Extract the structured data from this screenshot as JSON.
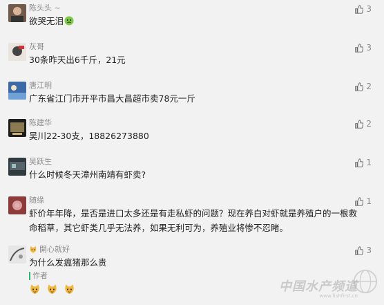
{
  "comments": [
    {
      "name": "陈头头 ~",
      "text": "欲哭无泪",
      "emoji": "sick-face",
      "likes": "3"
    },
    {
      "name": "灰哥",
      "text": "30条昨天出6千斤，21元",
      "likes": "3"
    },
    {
      "name": "唐江明",
      "text": "广东省江门市开平市昌大昌超市卖78元一斤",
      "likes": "2"
    },
    {
      "name": "陈建华",
      "text": "吴川22-30支，18826273880",
      "likes": "2"
    },
    {
      "name": "吴跃生",
      "text": "什么时候冬天漳州南靖有虾卖?",
      "likes": "1"
    },
    {
      "name": "随缘",
      "text_line1": "虾价年年降，是否是进口太多还是有走私虾的问题？现在养白对虾就是养殖户的一根救",
      "text_line2": "命稻草，其它虾类几乎无法养，如果无利可为，养殖业将惨不忍睹。",
      "likes": "1"
    },
    {
      "name": "開心就好",
      "text": "为什么发瘟猪那么贵",
      "likes": "3",
      "name_decoration": "cat-face"
    }
  ],
  "author_reply": {
    "label": "作者",
    "emojis": [
      "cat-face",
      "cat-face",
      "cat-face"
    ]
  },
  "watermark": {
    "text": "中国水产频道",
    "sub": "www.fishfirst.cn"
  },
  "colors": {
    "background": "#f2f2f2",
    "name": "#8a8a8a",
    "text": "#222222",
    "accent": "#2fb36d"
  }
}
